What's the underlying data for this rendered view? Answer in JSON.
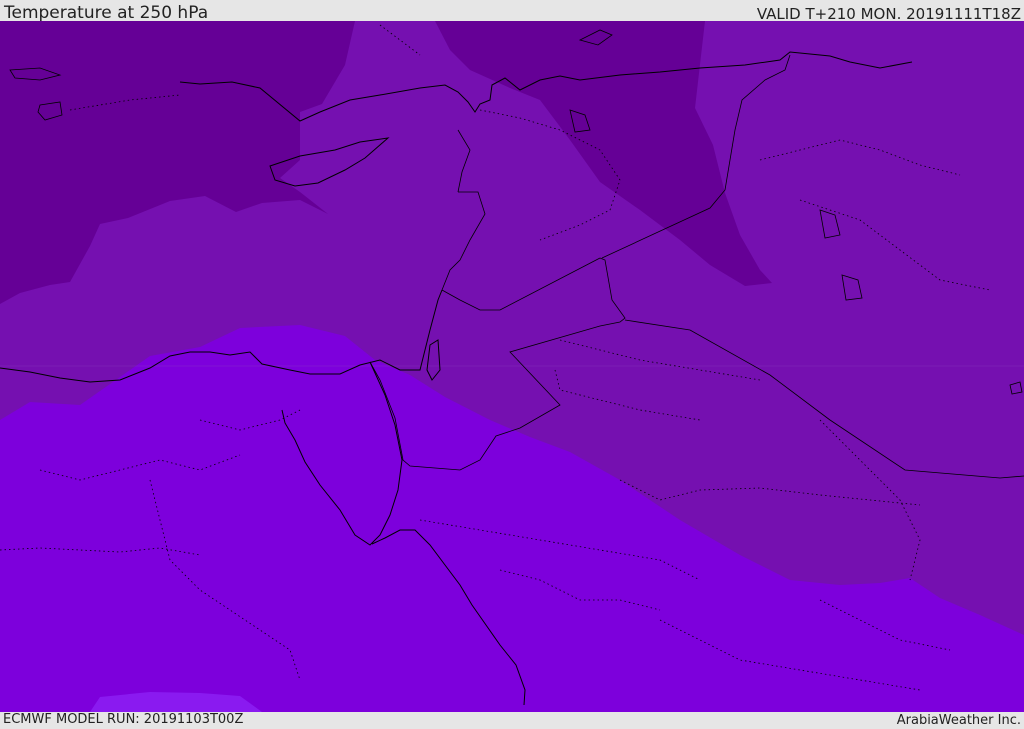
{
  "header": {
    "title": "Temperature at 250 hPa",
    "valid": "VALID T+210 MON. 20191111T18Z"
  },
  "footer": {
    "model_run": "ECMWF MODEL RUN: 20191103T00Z",
    "credit": "ArabiaWeather Inc."
  },
  "colors": {
    "band_dark": "#650096",
    "band_mid": "#7510b0",
    "band_bright": "#7d00dc",
    "band_brightest": "#8a1af0",
    "boundary": "#000000"
  }
}
